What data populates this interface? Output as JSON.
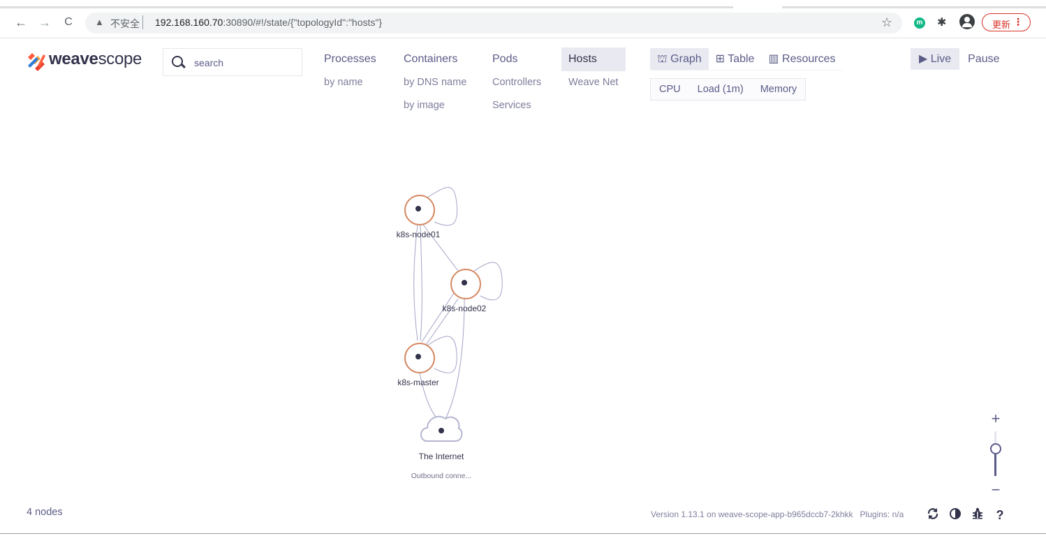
{
  "browser": {
    "insecure_label": "不安全",
    "url_host": "192.168.160.70",
    "url_rest": ":30890/#!/state/{\"topologyId\":\"hosts\"}",
    "extension_letter": "m",
    "update_label": "更新",
    "back_icon": "←",
    "forward_icon": "→",
    "reload_icon": "C",
    "warning_icon": "▲",
    "star_icon": "☆",
    "puzzle_icon": "✱",
    "menu_icon": "⋮"
  },
  "app": {
    "logo_bold": "weave",
    "logo_light": "scope",
    "search_placeholder": "search"
  },
  "topologies": [
    {
      "label": "Processes",
      "active": false,
      "subs": [
        "by name"
      ]
    },
    {
      "label": "Containers",
      "active": false,
      "subs": [
        "by DNS name",
        "by image"
      ]
    },
    {
      "label": "Pods",
      "active": false,
      "subs": [
        "Controllers",
        "Services"
      ]
    },
    {
      "label": "Hosts",
      "active": true,
      "subs": [
        "Weave Net"
      ]
    }
  ],
  "view_modes": [
    {
      "label": "Graph",
      "icon": "⛫",
      "active": true
    },
    {
      "label": "Table",
      "icon": "⊞",
      "active": false
    },
    {
      "label": "Resources",
      "icon": "▥",
      "active": false
    }
  ],
  "metrics": [
    "CPU",
    "Load (1m)",
    "Memory"
  ],
  "live_pause": [
    {
      "label": "Live",
      "icon": "▶",
      "active": true
    },
    {
      "label": "Pause",
      "active": false
    }
  ],
  "nodes": [
    {
      "label": "k8s-node01",
      "sublabel": ""
    },
    {
      "label": "k8s-node02",
      "sublabel": ""
    },
    {
      "label": "k8s-master",
      "sublabel": ""
    },
    {
      "label": "The Internet",
      "sublabel": "Outbound conne..."
    }
  ],
  "zoom": {
    "plus": "+",
    "minus": "−",
    "level": 0.6
  },
  "footer": {
    "node_count": "4 nodes",
    "version_text": "Version 1.13.1 on weave-scope-app-b965dccb7-2khkk",
    "plugins_text": "Plugins: n/a",
    "icons": [
      "refresh-icon",
      "contrast-icon",
      "bug-icon",
      "help-icon"
    ]
  },
  "colors": {
    "node_ring": "#d58760",
    "accent_text": "#5b5b88",
    "edge": "#a3a3c7",
    "active_bg": "#e9e9f1"
  }
}
